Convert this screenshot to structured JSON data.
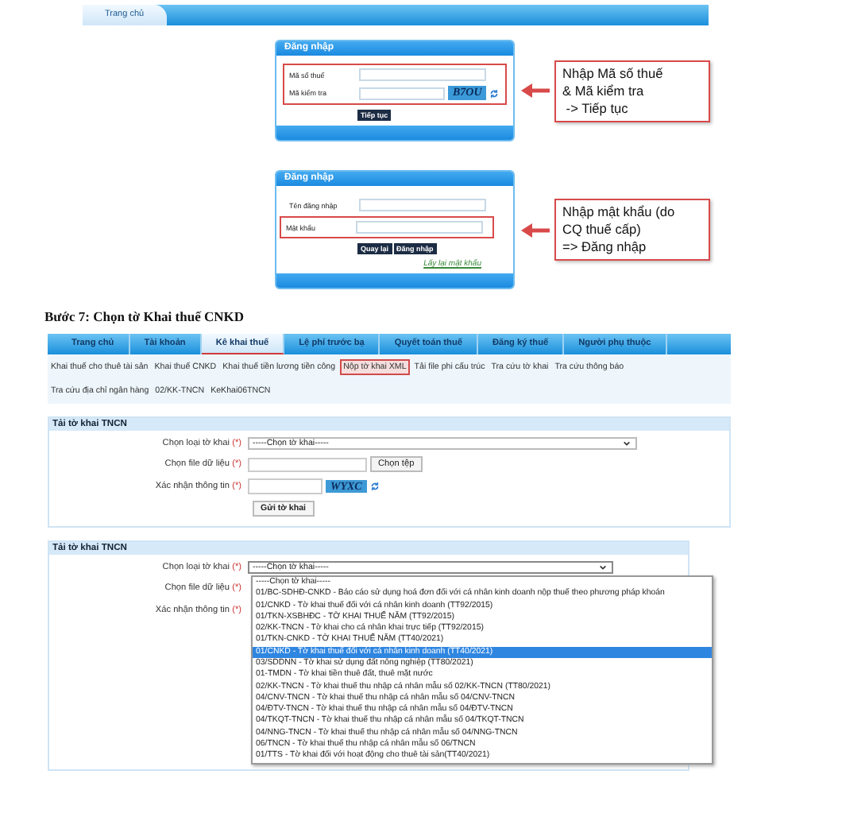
{
  "top_bar": {
    "tabs": [
      {
        "label": "Trang chủ",
        "selected": true
      }
    ]
  },
  "login_steps": [
    {
      "title": "Đăng nhập",
      "fields": [
        {
          "label": "Mã số thuế",
          "kind": "text"
        },
        {
          "label": "Mã kiểm tra",
          "kind": "captcha",
          "captcha": "B7OU"
        }
      ],
      "buttons": [
        "Tiếp tục"
      ],
      "callout": [
        "Nhập Mã số thuế",
        "& Mã kiểm tra",
        " -> Tiếp tục"
      ]
    },
    {
      "title": "Đăng nhập",
      "fields": [
        {
          "label": "Tên đăng nhập",
          "kind": "text"
        },
        {
          "label": "Mật khẩu",
          "kind": "text"
        }
      ],
      "buttons": [
        "Quay lại",
        "Đăng nhập"
      ],
      "link": "Lấy lại mật khẩu",
      "callout": [
        "Nhập mật khẩu (do",
        "CQ thuế cấp)",
        "=> Đăng nhập"
      ]
    }
  ],
  "heading": "Bước 7: Chọn tờ Khai thuế CNKD",
  "nav": {
    "tabs": [
      {
        "label": "Trang chủ",
        "selected": false
      },
      {
        "label": "Tài khoản",
        "selected": false
      },
      {
        "label": "Kê khai thuế",
        "selected": true
      },
      {
        "label": "Lệ phí trước bạ",
        "selected": false
      },
      {
        "label": "Quyết toán thuế",
        "selected": false
      },
      {
        "label": "Đăng ký thuế",
        "selected": false
      },
      {
        "label": "Người phụ thuộc",
        "selected": false
      }
    ]
  },
  "submenu": [
    [
      {
        "label": "Khai thuế cho thuê tài sản",
        "selected": false
      },
      {
        "label": "Khai thuế CNKD",
        "selected": false
      },
      {
        "label": "Khai thuế tiền lương tiền công",
        "selected": false
      },
      {
        "label": "Nộp tờ khai XML",
        "selected": true
      },
      {
        "label": "Tải file phi cấu trúc",
        "selected": false
      },
      {
        "label": "Tra cứu tờ khai",
        "selected": false
      },
      {
        "label": "Tra cứu thông báo",
        "selected": false
      }
    ],
    [
      {
        "label": "Tra cứu địa chỉ ngân hàng",
        "selected": false
      },
      {
        "label": "02/KK-TNCN",
        "selected": false
      },
      {
        "label": "KeKhai06TNCN",
        "selected": false
      }
    ]
  ],
  "forms": [
    {
      "title": "Tải tờ khai TNCN",
      "rows": [
        {
          "label": "Chọn loại tờ khai",
          "required": "(*)",
          "kind": "select",
          "value": "-----Chọn tờ khai-----"
        },
        {
          "label": "Chọn file dữ liệu",
          "required": "(*)",
          "kind": "file",
          "button": "Chọn tệp"
        },
        {
          "label": "Xác nhận thông tin",
          "required": "(*)",
          "kind": "captcha",
          "captcha": "WYXC"
        }
      ],
      "submit": "Gửi tờ khai"
    },
    {
      "title": "Tải tờ khai TNCN",
      "rows": [
        {
          "label": "Chọn loại tờ khai",
          "required": "(*)",
          "kind": "select",
          "value": "-----Chọn tờ khai-----",
          "open": true
        },
        {
          "label": "Chọn file dữ liệu",
          "required": "(*)",
          "kind": "hidden"
        },
        {
          "label": "Xác nhận thông tin",
          "required": "(*)",
          "kind": "hidden"
        }
      ],
      "options": [
        {
          "label": "-----Chọn tờ khai-----",
          "selected": false
        },
        {
          "label": "01/BC-SDHĐ-CNKD - Báo cáo sử dụng hoá đơn đối với cá nhân kinh doanh nộp thuế theo phương pháp khoán",
          "selected": false
        },
        {
          "label": "01/CNKD - Tờ khai thuế đối với cá nhân kinh doanh (TT92/2015)",
          "selected": false
        },
        {
          "label": "01/TKN-XSBHĐC - TỜ KHAI THUẾ NĂM (TT92/2015)",
          "selected": false
        },
        {
          "label": "02/KK-TNCN - Tờ khai cho cá nhân khai trực tiếp (TT92/2015)",
          "selected": false
        },
        {
          "label": "01/TKN-CNKD - TỜ KHAI THUẾ NĂM (TT40/2021)",
          "selected": false
        },
        {
          "label": "01/CNKD - Tờ khai thuế đối với cá nhân kinh doanh (TT40/2021)",
          "selected": true
        },
        {
          "label": "03/SDDNN - Tờ khai sử dụng đất nông nghiệp (TT80/2021)",
          "selected": false
        },
        {
          "label": "01-TMDN - Tờ khai tiền thuê đất, thuê mặt nước",
          "selected": false
        },
        {
          "label": "02/KK-TNCN - Tờ khai thuế thu nhập cá nhân mẫu số 02/KK-TNCN (TT80/2021)",
          "selected": false
        },
        {
          "label": "04/CNV-TNCN - Tờ khai thuế thu nhập cá nhân mẫu số 04/CNV-TNCN",
          "selected": false
        },
        {
          "label": "04/ĐTV-TNCN - Tờ khai thuế thu nhập cá nhân mẫu số 04/ĐTV-TNCN",
          "selected": false
        },
        {
          "label": "04/TKQT-TNCN - Tờ khai thuế thu nhập cá nhân mẫu số 04/TKQT-TNCN",
          "selected": false
        },
        {
          "label": "04/NNG-TNCN - Tờ khai thuế thu nhập cá nhân mẫu số 04/NNG-TNCN",
          "selected": false
        },
        {
          "label": "06/TNCN - Tờ khai thuế thu nhập cá nhân mẫu số 06/TNCN",
          "selected": false
        },
        {
          "label": "01/TTS - Tờ khai đối với hoạt động cho thuê tài sản(TT40/2021)",
          "selected": false
        }
      ]
    }
  ]
}
